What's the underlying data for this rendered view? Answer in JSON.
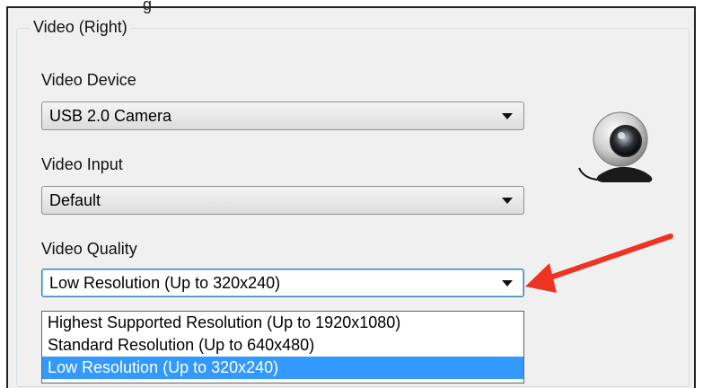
{
  "window": {
    "title_fragment": "g"
  },
  "group": {
    "legend": "Video (Right)"
  },
  "fields": {
    "device": {
      "label": "Video Device",
      "value": "USB 2.0 Camera"
    },
    "input": {
      "label": "Video Input",
      "value": "Default"
    },
    "quality": {
      "label": "Video Quality",
      "value": "Low Resolution (Up to 320x240)",
      "options": [
        "Highest Supported Resolution (Up to 1920x1080)",
        "Standard Resolution (Up to 640x480)",
        "Low Resolution (Up to 320x240)"
      ],
      "selected_index": 2
    }
  },
  "colors": {
    "selection": "#3399ff",
    "arrow": "#ee3322"
  },
  "icons": {
    "camera": "webcam-icon",
    "callout": "red-arrow-annotation"
  }
}
